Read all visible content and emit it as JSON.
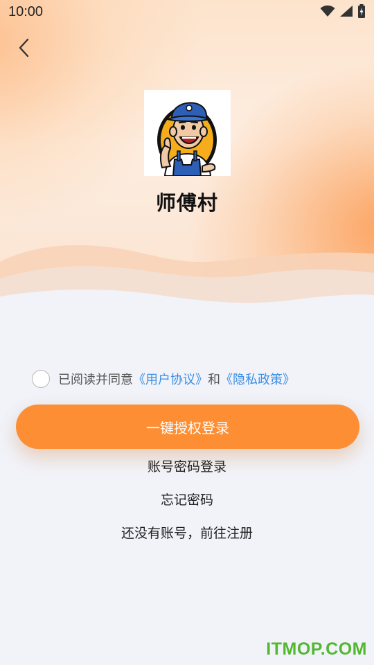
{
  "status_bar": {
    "time": "10:00",
    "icons": [
      "wifi-icon",
      "cellular-signal-icon",
      "battery-charging-icon"
    ]
  },
  "header": {
    "back_icon": "chevron-left-icon"
  },
  "app": {
    "logo_icon": "worker-mascot-logo",
    "name": "师傅村"
  },
  "agreement": {
    "prefix": "已阅读并同意",
    "user_agreement": "《用户协议》",
    "connector": "和",
    "privacy_policy": "《隐私政策》",
    "checked": false
  },
  "actions": {
    "primary_label": "一键授权登录",
    "account_login": "账号密码登录",
    "forgot_password": "忘记密码",
    "register": "还没有账号，前往注册"
  },
  "watermark": "ITMOP.COM",
  "colors": {
    "accent": "#fd8e33",
    "link": "#3a8ee6",
    "background": "#f1f3f9",
    "watermark": "#52b82f"
  }
}
